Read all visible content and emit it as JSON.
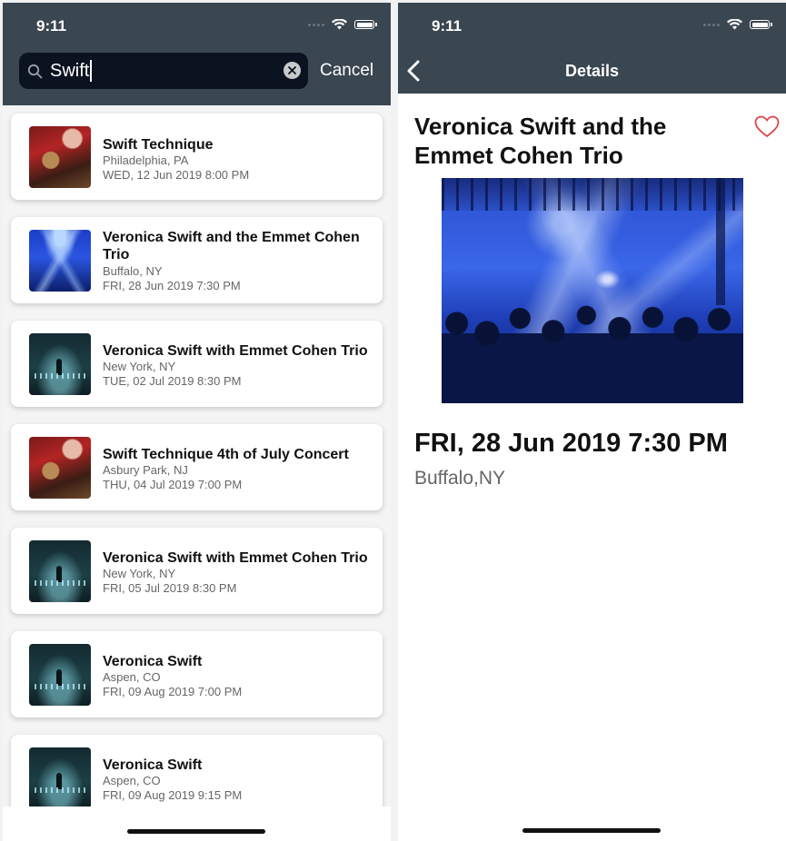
{
  "search_screen": {
    "status_bar": {
      "time": "9:11"
    },
    "search": {
      "value": "Swift",
      "cancel_label": "Cancel"
    },
    "results": [
      {
        "title": "Swift Technique",
        "place": "Philadelphia, PA",
        "date": "WED, 12 Jun 2019 8:00 PM",
        "thumbnail": "band"
      },
      {
        "title": "Veronica Swift and the Emmet Cohen Trio",
        "place": "Buffalo, NY",
        "date": "FRI, 28 Jun 2019 7:30 PM",
        "thumbnail": "concert"
      },
      {
        "title": "Veronica Swift with Emmet Cohen Trio",
        "place": "New York, NY",
        "date": "TUE, 02 Jul 2019 8:30 PM",
        "thumbnail": "stage"
      },
      {
        "title": "Swift Technique 4th of July Concert",
        "place": "Asbury Park, NJ",
        "date": "THU, 04 Jul 2019 7:00 PM",
        "thumbnail": "band"
      },
      {
        "title": "Veronica Swift with Emmet Cohen Trio",
        "place": "New York, NY",
        "date": "FRI, 05 Jul 2019 8:30 PM",
        "thumbnail": "stage"
      },
      {
        "title": "Veronica Swift",
        "place": "Aspen, CO",
        "date": "FRI, 09 Aug 2019 7:00 PM",
        "thumbnail": "stage"
      },
      {
        "title": "Veronica Swift",
        "place": "Aspen, CO",
        "date": "FRI, 09 Aug 2019 9:15 PM",
        "thumbnail": "stage"
      }
    ]
  },
  "detail_screen": {
    "status_bar": {
      "time": "9:11"
    },
    "nav": {
      "title": "Details"
    },
    "title": "Veronica Swift and the Emmet Cohen Trio",
    "date": "FRI, 28 Jun 2019 7:30 PM",
    "place": "Buffalo,NY",
    "favorite": false
  },
  "colors": {
    "header": "#3a4650",
    "search_field": "#0b1220",
    "heart": "#e0474c"
  }
}
